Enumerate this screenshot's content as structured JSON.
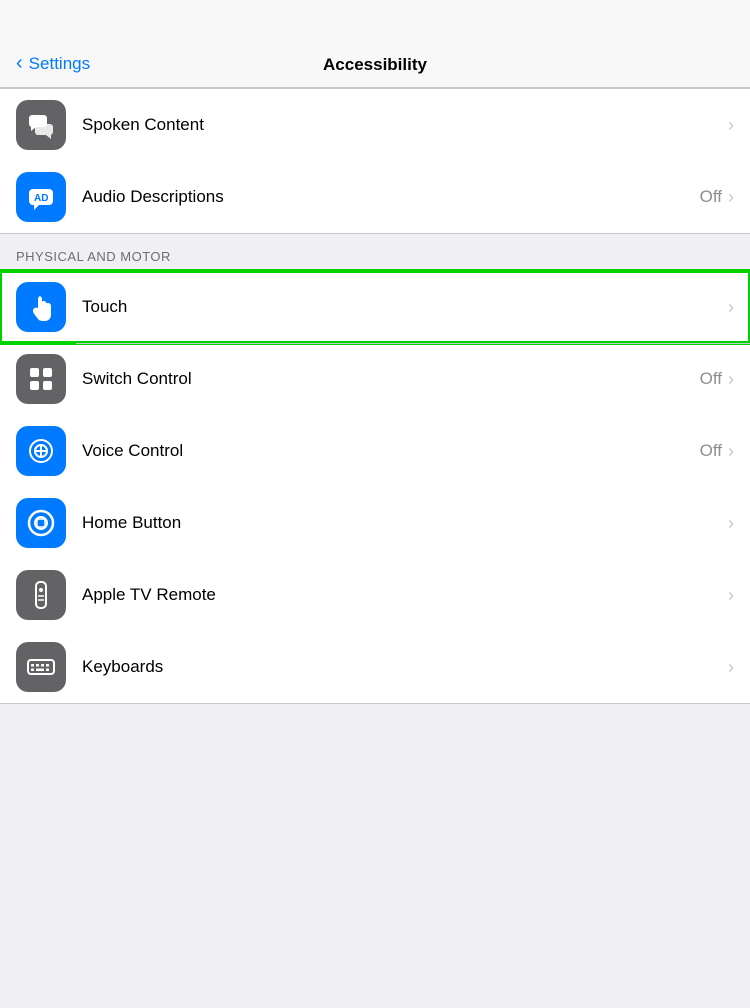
{
  "nav": {
    "back_label": "Settings",
    "title": "Accessibility"
  },
  "sections": [
    {
      "id": "vision",
      "label": null,
      "items": [
        {
          "id": "spoken-content",
          "label": "Spoken Content",
          "status": null,
          "icon_color": "gray",
          "icon_type": "spoken-content"
        },
        {
          "id": "audio-descriptions",
          "label": "Audio Descriptions",
          "status": "Off",
          "icon_color": "blue",
          "icon_type": "audio-descriptions"
        }
      ]
    },
    {
      "id": "physical-motor",
      "label": "PHYSICAL AND MOTOR",
      "items": [
        {
          "id": "touch",
          "label": "Touch",
          "status": null,
          "icon_color": "blue",
          "icon_type": "touch",
          "highlighted": true
        },
        {
          "id": "switch-control",
          "label": "Switch Control",
          "status": "Off",
          "icon_color": "gray",
          "icon_type": "switch-control"
        },
        {
          "id": "voice-control",
          "label": "Voice Control",
          "status": "Off",
          "icon_color": "blue",
          "icon_type": "voice-control"
        },
        {
          "id": "home-button",
          "label": "Home Button",
          "status": null,
          "icon_color": "blue",
          "icon_type": "home-button"
        },
        {
          "id": "apple-tv-remote",
          "label": "Apple TV Remote",
          "status": null,
          "icon_color": "gray",
          "icon_type": "apple-tv-remote"
        },
        {
          "id": "keyboards",
          "label": "Keyboards",
          "status": null,
          "icon_color": "gray",
          "icon_type": "keyboards"
        }
      ]
    }
  ]
}
